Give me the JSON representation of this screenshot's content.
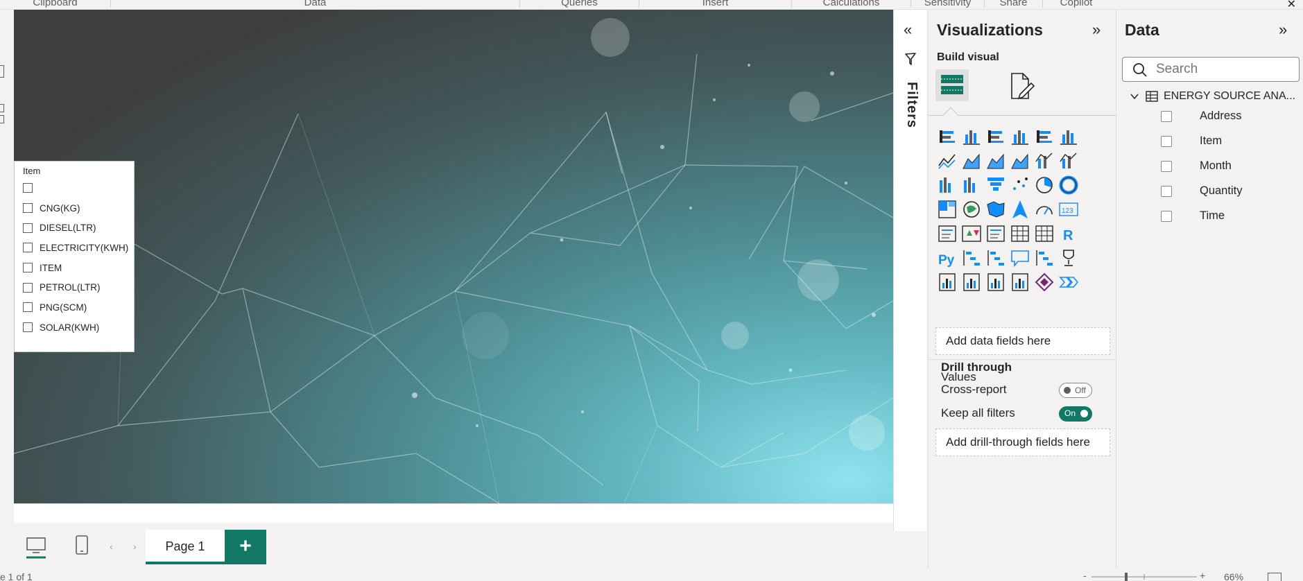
{
  "ribbon": {
    "groups": [
      "Clipboard",
      "Data",
      "Queries",
      "Insert",
      "Calculations",
      "Sensitivity",
      "Share",
      "Copilot"
    ]
  },
  "slicer": {
    "title": "Item",
    "items": [
      "",
      "CNG(KG)",
      "DIESEL(LTR)",
      "ELECTRICITY(KWH)",
      "ITEM",
      "PETROL(LTR)",
      "PNG(SCM)",
      "SOLAR(KWH)"
    ]
  },
  "pages": {
    "tabs": [
      {
        "label": "Page 1",
        "active": true
      }
    ],
    "add_label": "+"
  },
  "status": {
    "page_indicator": "e 1 of 1",
    "zoom_percent": "66%"
  },
  "filters": {
    "label": "Filters"
  },
  "visualizations": {
    "title": "Visualizations",
    "build_visual": "Build visual",
    "more": "...",
    "values_label": "Values",
    "values_placeholder": "Add data fields here",
    "drill_through": "Drill through",
    "cross_report": "Cross-report",
    "cross_report_state": "Off",
    "keep_all_filters": "Keep all filters",
    "keep_all_filters_state": "On",
    "drill_placeholder": "Add drill-through fields here",
    "icons": [
      "stacked-bar-chart-icon",
      "stacked-column-chart-icon",
      "clustered-bar-chart-icon",
      "clustered-column-chart-icon",
      "100-stacked-bar-chart-icon",
      "100-stacked-column-chart-icon",
      "line-chart-icon",
      "area-chart-icon",
      "stacked-area-chart-icon",
      "100-stacked-area-chart-icon",
      "line-stacked-column-icon",
      "line-clustered-column-icon",
      "ribbon-chart-icon",
      "waterfall-chart-icon",
      "funnel-chart-icon",
      "scatter-chart-icon",
      "pie-chart-icon",
      "donut-chart-icon",
      "treemap-icon",
      "map-icon",
      "filled-map-icon",
      "azure-map-icon",
      "gauge-icon",
      "card-icon",
      "multi-row-card-icon",
      "kpi-icon",
      "slicer-icon",
      "table-icon",
      "matrix-icon",
      "r-visual-icon",
      "python-visual-icon",
      "key-influencers-icon",
      "decomposition-tree-icon",
      "qna-icon",
      "smart-narrative-icon",
      "metrics-icon",
      "paginated-report-icon",
      "new-card-icon",
      "button-slicer-icon",
      "azure-map-2-icon",
      "power-apps-icon",
      "power-automate-icon"
    ],
    "accent": "#118dff"
  },
  "data_pane": {
    "title": "Data",
    "search_placeholder": "Search",
    "table": "ENERGY SOURCE ANA...",
    "fields": [
      "Address",
      "Item",
      "Month",
      "Quantity",
      "Time"
    ]
  },
  "colors": {
    "brand_green": "#117865",
    "canvas_dark": "#3d3e3e",
    "canvas_teal": "#8fe3ee"
  }
}
